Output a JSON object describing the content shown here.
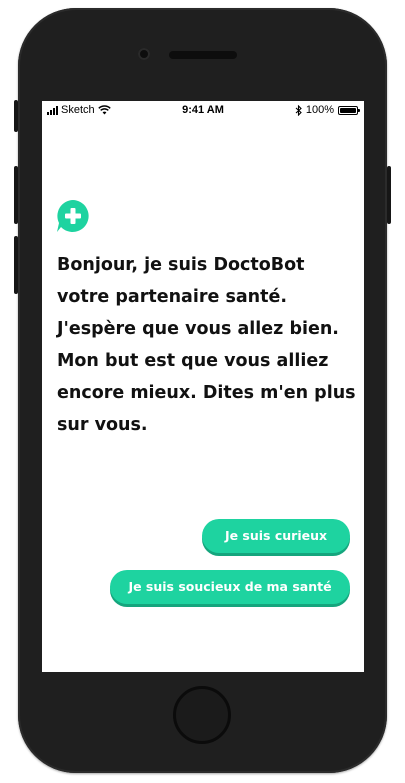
{
  "status_bar": {
    "carrier": "Sketch",
    "time": "9:41 AM",
    "battery_percent": "100%"
  },
  "chat": {
    "bot_message": "Bonjour, je suis DoctoBot votre partenaire santé. J'espère que vous allez bien. Mon but est que vous alliez encore mieux. Dites m'en plus sur vous.",
    "quick_replies": [
      {
        "label": "Je suis curieux"
      },
      {
        "label": "Je suis soucieux de ma santé"
      }
    ]
  },
  "colors": {
    "accent": "#1ED3A0",
    "accent_shadow": "#15A57D",
    "text": "#111111",
    "device_frame": "#1F1F1F"
  },
  "icons": {
    "bot_avatar": "medical-cross-chat-bubble-icon"
  }
}
